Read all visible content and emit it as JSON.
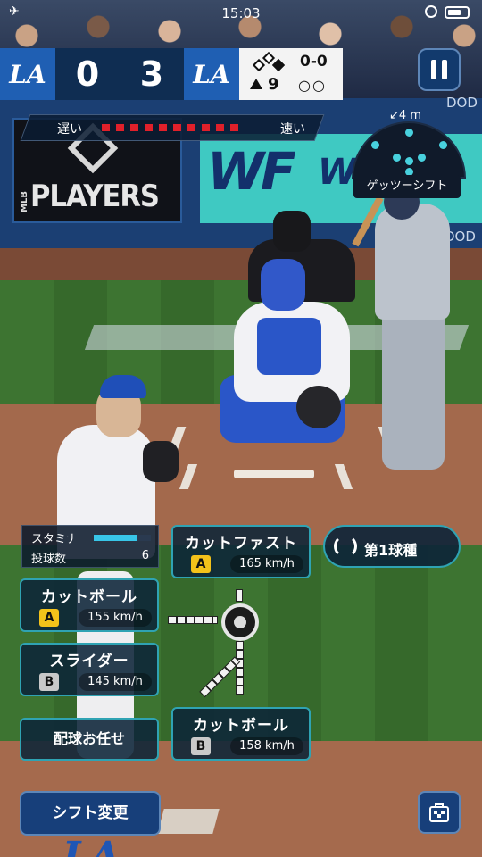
{
  "status_bar": {
    "time": "15:03"
  },
  "scoreboard": {
    "away_logo": "LA",
    "away_score": "0",
    "home_score": "3",
    "home_logo": "LA",
    "inning": "9",
    "inning_half": "top",
    "count": "0-0",
    "outs_display": "○○",
    "runners": {
      "first": true,
      "second": false,
      "third": false
    }
  },
  "stadium": {
    "board_left_text": "PLAYERS",
    "board_left_small": "MLB",
    "board_right_text": "WF",
    "board_right_text2": "Wh",
    "wall_text": "DOD",
    "wall_text_lower": "DOD",
    "bottom_logo": "LA"
  },
  "speed_meter": {
    "slow_label": "遅い",
    "fast_label": "速い",
    "level_dots": 10
  },
  "shift": {
    "distance": "↙4 m",
    "label": "ゲッツーシフト"
  },
  "stamina": {
    "label": "スタミナ",
    "level": 0.75,
    "pitch_count_label": "投球数",
    "pitch_count": "6"
  },
  "pitches": [
    {
      "name": "カットファスト",
      "grade": "A",
      "speed": "165 km/h"
    },
    {
      "name": "カットボール",
      "grade": "A",
      "speed": "155 km/h"
    },
    {
      "name": "スライダー",
      "grade": "B",
      "speed": "145 km/h"
    },
    {
      "name": "カットボール",
      "grade": "B",
      "speed": "158 km/h"
    }
  ],
  "pitch_type_button": {
    "label": "第1球種",
    "icon": "refresh-icon"
  },
  "auto_button": {
    "label": "配球お任せ"
  },
  "shift_change_button": {
    "label": "シフト変更"
  },
  "icons": {
    "pause": "pause-icon",
    "bag": "bag-icon",
    "ball": "baseball-icon"
  },
  "colors": {
    "accent": "#2fa3b3",
    "grade_a": "#f3c21a",
    "grade_b": "#c9c9c9",
    "navy": "#0f2d52",
    "speed_dot": "#e0202a"
  }
}
